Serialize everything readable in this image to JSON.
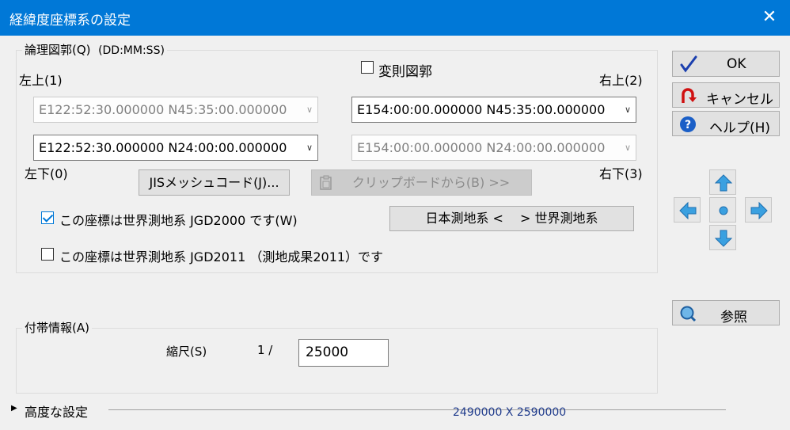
{
  "window": {
    "title": "経緯度座標系の設定",
    "close_glyph": "✕"
  },
  "extent_group": {
    "legend": "論理図郭(Q)",
    "format": "(DD:MM:SS)",
    "transform_label": "変則図郭",
    "top_left_label": "左上(1)",
    "top_right_label": "右上(2)",
    "bottom_left_label": "左下(0)",
    "bottom_right_label": "右下(3)",
    "top_left_value": "E122:52:30.000000 N45:35:00.000000",
    "top_right_value": "E154:00:00.000000 N45:35:00.000000",
    "bottom_left_value": "E122:52:30.000000 N24:00:00.000000",
    "bottom_right_value": "E154:00:00.000000 N24:00:00.000000",
    "jis_button": "JISメッシュコード(J)...",
    "clipboard_button": "クリップボードから(B) >>",
    "jgd2000_label": "この座標は世界測地系 JGD2000 です(W)",
    "jgd2000_checked": true,
    "jgd2011_label": "この座標は世界測地系 JGD2011 （測地成果2011）です",
    "jgd2011_checked": false,
    "convert_button": "日本測地系 <　 > 世界測地系"
  },
  "side": {
    "ok_label": "OK",
    "cancel_label": "キャンセル",
    "help_label": "ヘルプ(H)",
    "ref_label": "参照"
  },
  "extra_group": {
    "legend": "付帯情報(A)",
    "scale_label": "縮尺(S)",
    "scale_prefix": "1 /",
    "scale_value": "25000"
  },
  "advanced": {
    "label": "高度な設定",
    "size_text": "2490000 X 2590000"
  },
  "colors": {
    "titlebar": "#0078d7",
    "check": "#0078d7",
    "arrow_fill": "#3aa0e0",
    "size_text": "#1f3b8c"
  }
}
